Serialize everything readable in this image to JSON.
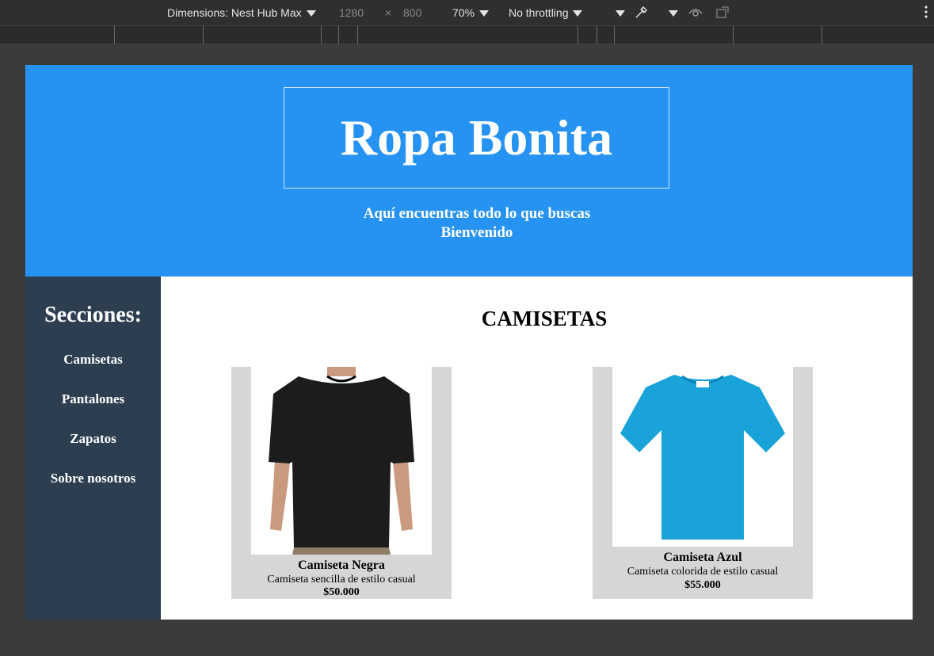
{
  "devtools": {
    "dimensions_label": "Dimensions: Nest Hub Max",
    "width": "1280",
    "times": "×",
    "height": "800",
    "zoom": "70%",
    "throttling": "No throttling"
  },
  "header": {
    "title": "Ropa Bonita",
    "tagline": "Aquí encuentras todo lo que buscas",
    "welcome": "Bienvenido"
  },
  "sidebar": {
    "title": "Secciones:",
    "items": [
      {
        "label": "Camisetas"
      },
      {
        "label": "Pantalones"
      },
      {
        "label": "Zapatos"
      },
      {
        "label": "Sobre nosotros"
      }
    ]
  },
  "main": {
    "section_title": "CAMISETAS",
    "products": [
      {
        "name": "Camiseta Negra",
        "description": "Camiseta sencilla de estilo casual",
        "price": "$50.000",
        "color": "#1c1c1c"
      },
      {
        "name": "Camiseta Azul",
        "description": "Camiseta colorida de estilo casual",
        "price": "$55.000",
        "color": "#1aa3d9"
      }
    ]
  }
}
